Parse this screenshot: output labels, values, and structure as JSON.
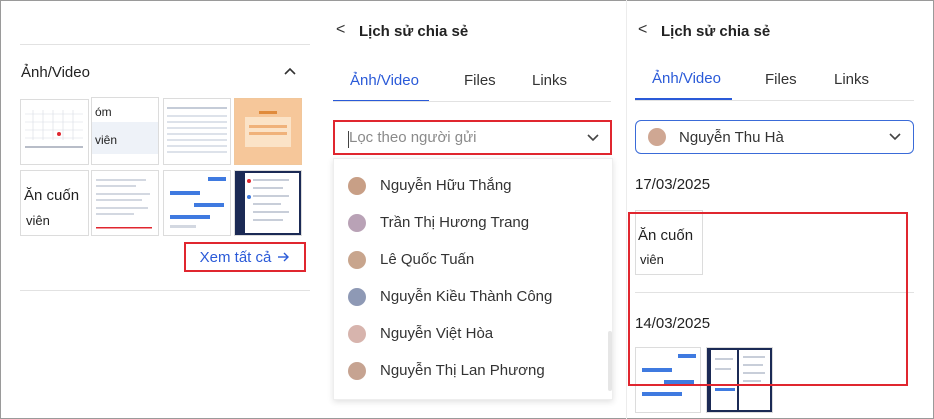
{
  "panel1": {
    "section_title": "Ảnh/Video",
    "see_all": "Xem tất cả",
    "thumb_text": {
      "a": "óm",
      "b": "viên",
      "c": "Ăn cuốn",
      "d": "viên"
    }
  },
  "panel2": {
    "back": "<",
    "title": "Lịch sử chia sẻ",
    "tabs": [
      "Ảnh/Video",
      "Files",
      "Links"
    ],
    "filter_placeholder": "Lọc theo người gửi",
    "senders": [
      "Nguyễn Hữu Thắng",
      "Trần Thị Hương Trang",
      "Lê Quốc Tuấn",
      "Nguyễn Kiều Thành Công",
      "Nguyễn Việt Hòa",
      "Nguyễn Thị Lan Phương"
    ]
  },
  "panel3": {
    "back": "<",
    "title": "Lịch sử chia sẻ",
    "tabs": [
      "Ảnh/Video",
      "Files",
      "Links"
    ],
    "selected_sender": "Nguyễn Thu Hà",
    "dates": [
      "17/03/2025",
      "14/03/2025"
    ],
    "thumb_text": {
      "a": "Ăn cuốn",
      "b": "viên"
    }
  },
  "colors": {
    "accent": "#2a5ad8",
    "highlight": "#e0262f"
  }
}
